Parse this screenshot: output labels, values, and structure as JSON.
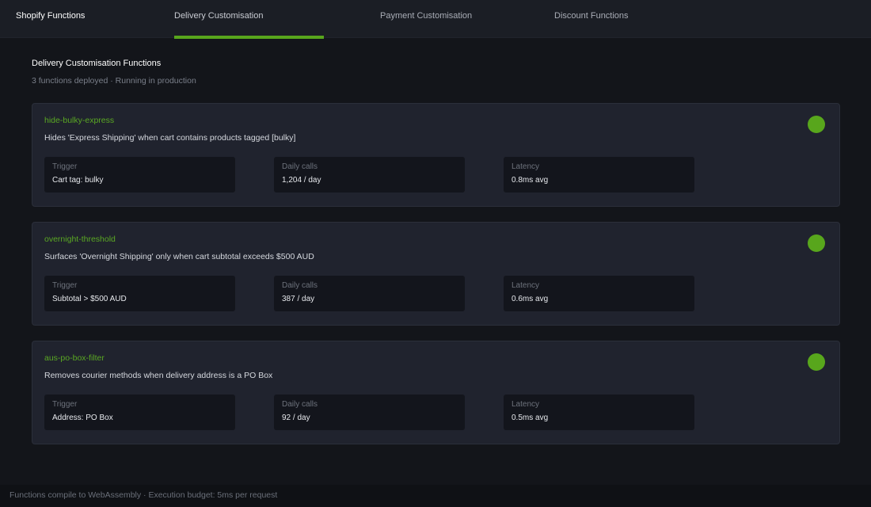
{
  "nav": {
    "brand": "Shopify Functions",
    "tabs": [
      {
        "label": "Delivery Customisation",
        "active": true
      },
      {
        "label": "Payment Customisation",
        "active": false
      },
      {
        "label": "Discount Functions",
        "active": false
      }
    ]
  },
  "header": {
    "title": "Delivery Customisation Functions",
    "subtitle": "3 functions deployed · Running in production"
  },
  "functions": [
    {
      "name": "hide-bulky-express",
      "description": "Hides 'Express Shipping' when cart contains products tagged [bulky]",
      "metrics": [
        {
          "label": "Trigger",
          "value": "Cart tag: bulky"
        },
        {
          "label": "Daily calls",
          "value": "1,204 / day"
        },
        {
          "label": "Latency",
          "value": "0.8ms avg"
        }
      ]
    },
    {
      "name": "overnight-threshold",
      "description": "Surfaces 'Overnight Shipping' only when cart subtotal exceeds $500 AUD",
      "metrics": [
        {
          "label": "Trigger",
          "value": "Subtotal > $500 AUD"
        },
        {
          "label": "Daily calls",
          "value": "387 / day"
        },
        {
          "label": "Latency",
          "value": "0.6ms avg"
        }
      ]
    },
    {
      "name": "aus-po-box-filter",
      "description": "Removes courier methods when delivery address is a PO Box",
      "metrics": [
        {
          "label": "Trigger",
          "value": "Address: PO Box"
        },
        {
          "label": "Daily calls",
          "value": "92 / day"
        },
        {
          "label": "Latency",
          "value": "0.5ms avg"
        }
      ]
    }
  ],
  "footer": {
    "text": "Functions compile to WebAssembly · Execution budget: 5ms per request"
  },
  "colors": {
    "accent": "#58a61c",
    "background": "#13151a",
    "card": "#20232e"
  }
}
